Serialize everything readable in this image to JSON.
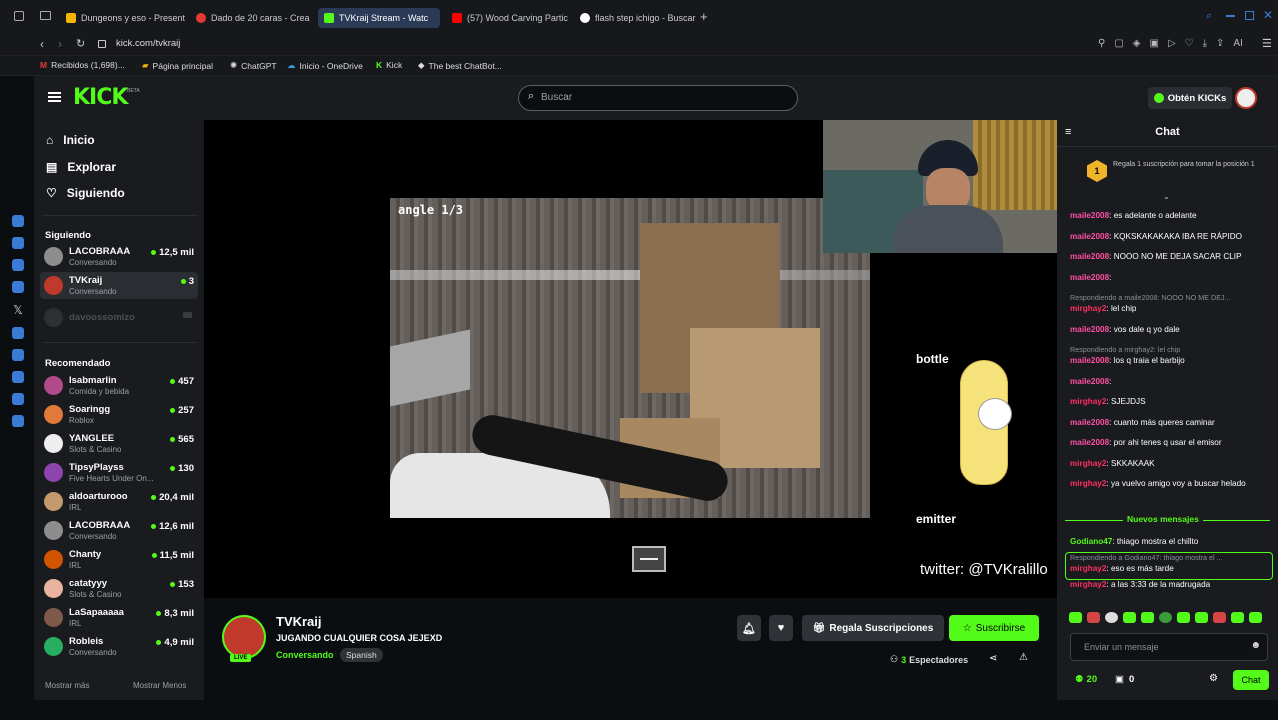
{
  "browser": {
    "tabs": [
      {
        "label": "Dungeons y eso - Present",
        "color": "#f4b400"
      },
      {
        "label": "Dado de 20 caras - Crea",
        "color": "#e53935"
      },
      {
        "label": "TVKraij Stream - Watc",
        "color": "#53fc18",
        "active": true
      },
      {
        "label": "(57) Wood Carving Partic",
        "color": "#ff0000"
      },
      {
        "label": "flash step ichigo - Buscar",
        "color": "#ffffff"
      }
    ],
    "new_tab": "+",
    "url": "kick.com/tvkraij",
    "bookmarks": [
      "Recibidos (1,698)...",
      "Página principal",
      "ChatGPT",
      "Inicio - OneDrive",
      "Kick",
      "The best ChatBot..."
    ],
    "ext_label": "AI"
  },
  "kick": {
    "logo": "KICK",
    "logo_sup": "BETA",
    "search_placeholder": "Buscar",
    "get_kicks": "Obtén KICKs",
    "nav": [
      {
        "label": "Inicio",
        "icon": "home-icon"
      },
      {
        "label": "Explorar",
        "icon": "compass-icon"
      },
      {
        "label": "Siguiendo",
        "icon": "heart-icon"
      }
    ],
    "following_title": "Siguiendo",
    "following": [
      {
        "name": "LACOBRAAA",
        "category": "Conversando",
        "viewers": "12,5 mil",
        "color": "#8d8d8d"
      },
      {
        "name": "TVKraij",
        "category": "Conversando",
        "viewers": "3",
        "color": "#c0392b",
        "active": true
      },
      {
        "name": "davoossomizo",
        "category": "",
        "viewers": "",
        "color": "#555555",
        "offline": true
      }
    ],
    "recommended_title": "Recomendado",
    "recommended": [
      {
        "name": "Isabmarlin",
        "category": "Comida y bebida",
        "viewers": "457",
        "color": "#b04a8a"
      },
      {
        "name": "Soaringg",
        "category": "Roblox",
        "viewers": "257",
        "color": "#e07a3a"
      },
      {
        "name": "YANGLEE",
        "category": "Slots & Casino",
        "viewers": "565",
        "color": "#eeeeee"
      },
      {
        "name": "TipsyPlayss",
        "category": "Five Hearts Under On...",
        "viewers": "130",
        "color": "#8e44ad"
      },
      {
        "name": "aldoarturooo",
        "category": "IRL",
        "viewers": "20,4 mil",
        "color": "#c49a6c"
      },
      {
        "name": "LACOBRAAA",
        "category": "Conversando",
        "viewers": "12,6 mil",
        "color": "#8d8d8d"
      },
      {
        "name": "Chanty",
        "category": "IRL",
        "viewers": "11,5 mil",
        "color": "#d35400"
      },
      {
        "name": "catatyyy",
        "category": "Slots & Casino",
        "viewers": "153",
        "color": "#e8b4a0"
      },
      {
        "name": "LaSapaaaaa",
        "category": "IRL",
        "viewers": "8,3 mil",
        "color": "#7f5a4a"
      },
      {
        "name": "Robleis",
        "category": "Conversando",
        "viewers": "4,9 mil",
        "color": "#27ae60"
      }
    ],
    "show_more": "Mostrar más",
    "show_less": "Mostrar Menos"
  },
  "video": {
    "angle_label": "angle 1/3",
    "overlay_bottle": "bottle",
    "overlay_emitter": "emitter",
    "twitter": "twitter: @TVKralillo"
  },
  "stream": {
    "name": "TVKraij",
    "title": "JUGANDO CUALQUIER COSA JEJEXD",
    "category": "Conversando",
    "tag": "Spanish",
    "live_badge": "LIVE",
    "gift_label": "Regala Suscripciones",
    "subscribe_label": "Suscribirse",
    "viewers_count": "3",
    "viewers_label": "Espectadores"
  },
  "chat": {
    "title": "Chat",
    "pinned": "Regala 1 suscripción para tomar la posición 1",
    "pinned_rank": "1",
    "new_messages": "Nuevos mensajes",
    "messages": [
      {
        "user": "maile2008",
        "text": ": es adelante o adelante"
      },
      {
        "user": "maile2008",
        "text": ": KQKSKAKAKAKA IBA RE RÁPIDO"
      },
      {
        "user": "maile2008",
        "text": ": NOOO NO ME DEJA SACAR CLIP"
      },
      {
        "user": "maile2008",
        "text": ":"
      },
      {
        "reply": "Respondiendo a maile2008: NOOO NO ME DEJ..."
      },
      {
        "user": "mirghay2",
        "text": ": lel chip"
      },
      {
        "user": "maile2008",
        "text": ": vos dale q yo dale"
      },
      {
        "reply": "Respondiendo a mirghay2: lel chip"
      },
      {
        "user": "maile2008",
        "text": ": los q traia el barbijo"
      },
      {
        "user": "maile2008",
        "text": ":"
      },
      {
        "user": "mirghay2",
        "text": ": SJEJDJS"
      },
      {
        "user": "maile2008",
        "text": ": cuanto más queres caminar"
      },
      {
        "user": "maile2008",
        "text": ": por ahi tenes q usar el emisor"
      },
      {
        "user": "mirghay2",
        "text": ": SKKAKAAK"
      },
      {
        "user": "mirghay2",
        "text": ": ya vuelvo amigo voy a buscar helado"
      }
    ],
    "after_messages": [
      {
        "user": "Godiano47",
        "text": ": thiago mostra el chillto"
      },
      {
        "reply": "Respondiendo a Godiano47: thiago mostra el ..."
      },
      {
        "user": "mirghay2",
        "text": ": eso es más tarde"
      },
      {
        "user": "mirghay2",
        "text": ": a las 3:33 de la madrugada"
      }
    ],
    "input_placeholder": "Enviar un mensaje",
    "kicks_count": "20",
    "gift_count": "0",
    "send_label": "Chat"
  }
}
